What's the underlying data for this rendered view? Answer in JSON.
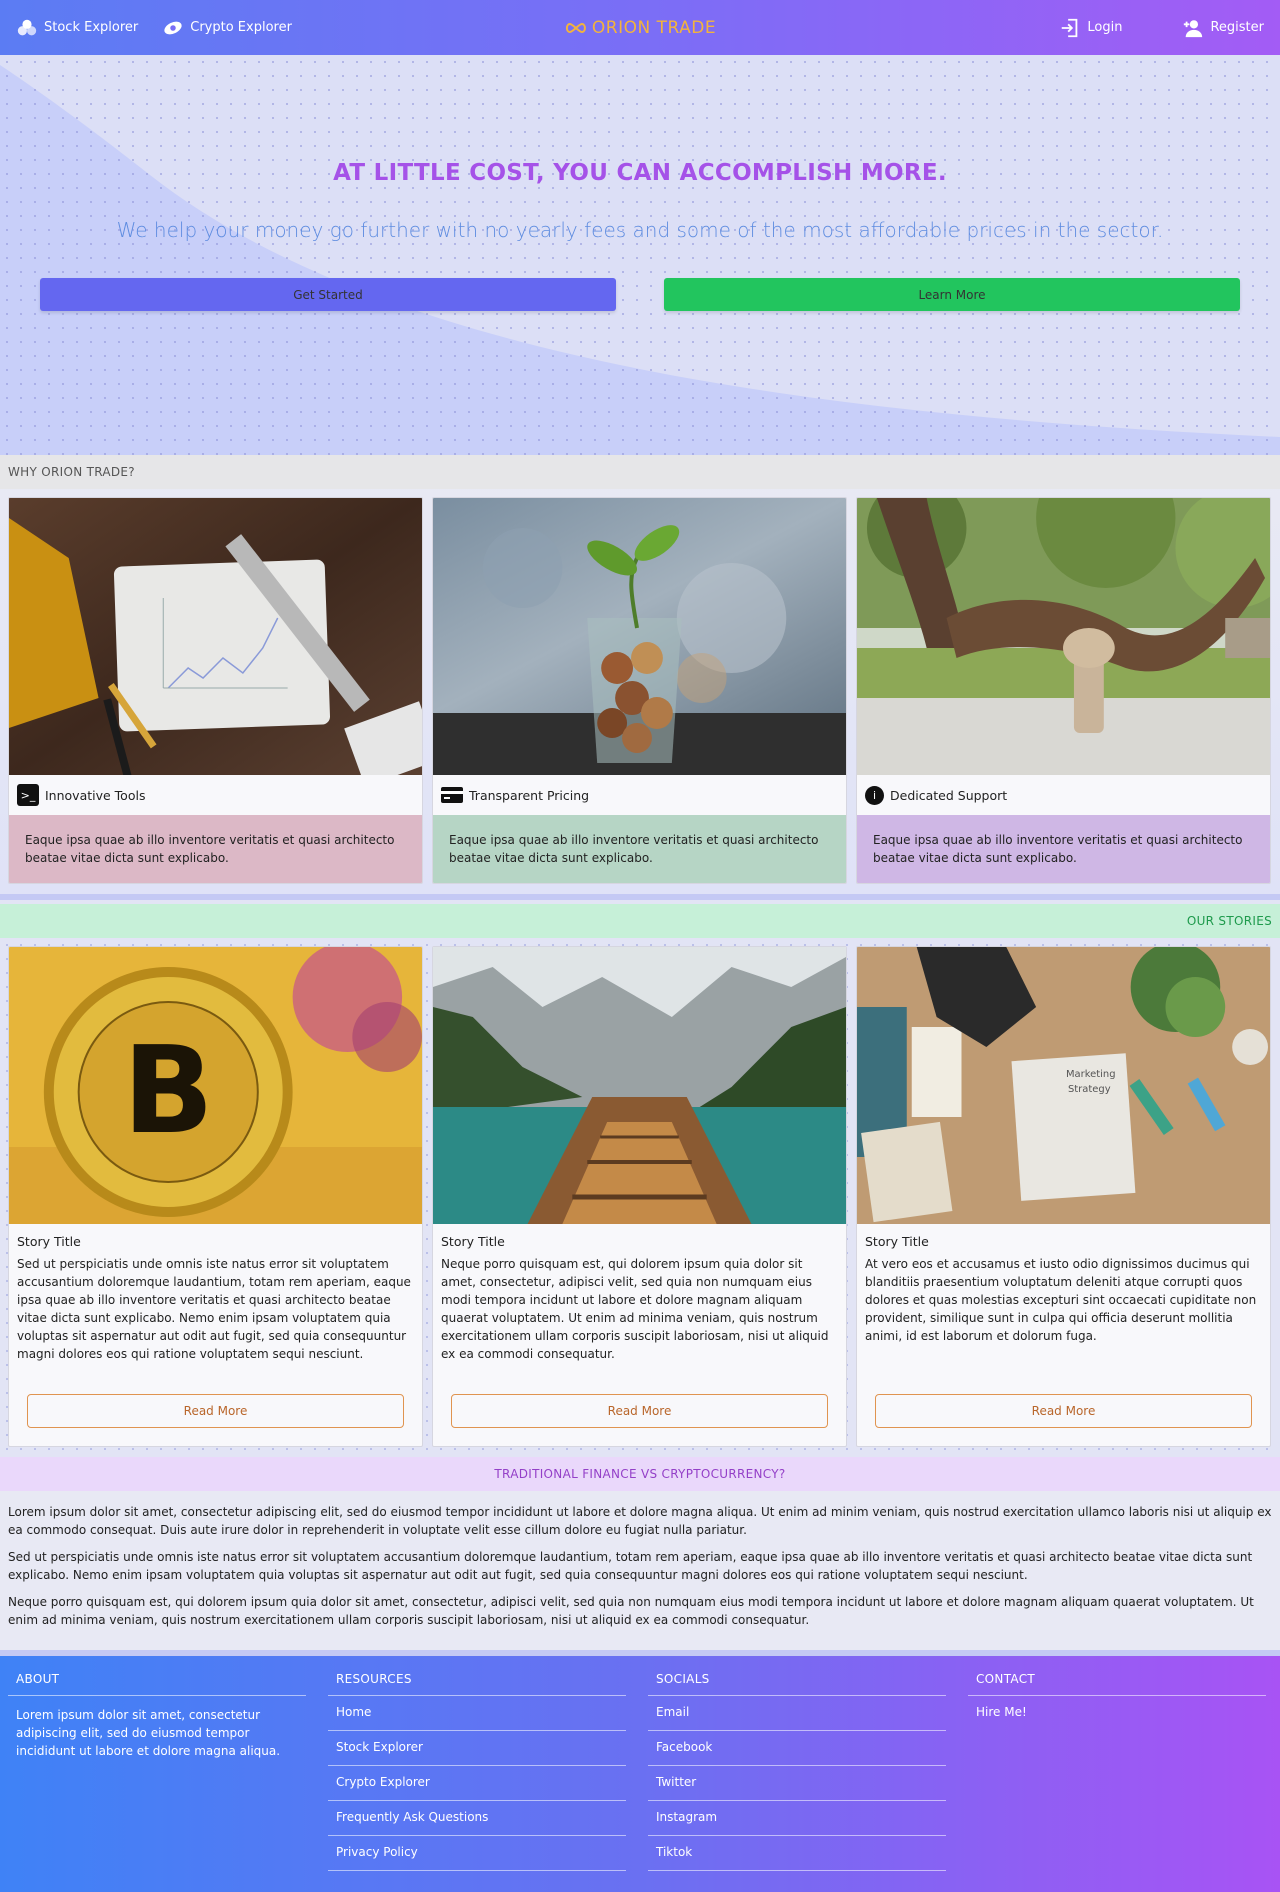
{
  "nav": {
    "stock_label": "Stock Explorer",
    "crypto_label": "Crypto Explorer",
    "brand": "ORION TRADE",
    "login_label": "Login",
    "register_label": "Register"
  },
  "hero": {
    "title": "AT LITTLE COST, YOU CAN ACCOMPLISH MORE.",
    "subtitle": "We help your money go further with no yearly fees and some of the most affordable prices in the sector.",
    "get_started": "Get Started",
    "learn_more": "Learn More"
  },
  "why": {
    "heading": "WHY ORION TRADE?",
    "cards": [
      {
        "title": "Innovative Tools",
        "icon": "terminal-icon",
        "text": "Eaque ipsa quae ab illo inventore veritatis et quasi architecto beatae vitae dicta sunt explicabo."
      },
      {
        "title": "Transparent Pricing",
        "icon": "credit-card-icon",
        "text": "Eaque ipsa quae ab illo inventore veritatis et quasi architecto beatae vitae dicta sunt explicabo."
      },
      {
        "title": "Dedicated Support",
        "icon": "info-icon",
        "text": "Eaque ipsa quae ab illo inventore veritatis et quasi architecto beatae vitae dicta sunt explicabo."
      }
    ]
  },
  "stories": {
    "heading": "OUR STORIES",
    "cards": [
      {
        "title": "Story Title",
        "text": "Sed ut perspiciatis unde omnis iste natus error sit voluptatem accusantium doloremque laudantium, totam rem aperiam, eaque ipsa quae ab illo inventore veritatis et quasi architecto beatae vitae dicta sunt explicabo. Nemo enim ipsam voluptatem quia voluptas sit aspernatur aut odit aut fugit, sed quia consequuntur magni dolores eos qui ratione voluptatem sequi nesciunt.",
        "button": "Read More"
      },
      {
        "title": "Story Title",
        "text": "Neque porro quisquam est, qui dolorem ipsum quia dolor sit amet, consectetur, adipisci velit, sed quia non numquam eius modi tempora incidunt ut labore et dolore magnam aliquam quaerat voluptatem. Ut enim ad minima veniam, quis nostrum exercitationem ullam corporis suscipit laboriosam, nisi ut aliquid ex ea commodi consequatur.",
        "button": "Read More"
      },
      {
        "title": "Story Title",
        "text": "At vero eos et accusamus et iusto odio dignissimos ducimus qui blanditiis praesentium voluptatum deleniti atque corrupti quos dolores et quas molestias excepturi sint occaecati cupiditate non provident, similique sunt in culpa qui officia deserunt mollitia animi, id est laborum et dolorum fuga.",
        "button": "Read More"
      }
    ]
  },
  "finance": {
    "heading": "TRADITIONAL FINANCE VS CRYPTOCURRENCY?",
    "paragraphs": [
      "Lorem ipsum dolor sit amet, consectetur adipiscing elit, sed do eiusmod tempor incididunt ut labore et dolore magna aliqua. Ut enim ad minim veniam, quis nostrud exercitation ullamco laboris nisi ut aliquip ex ea commodo consequat. Duis aute irure dolor in reprehenderit in voluptate velit esse cillum dolore eu fugiat nulla pariatur.",
      "Sed ut perspiciatis unde omnis iste natus error sit voluptatem accusantium doloremque laudantium, totam rem aperiam, eaque ipsa quae ab illo inventore veritatis et quasi architecto beatae vitae dicta sunt explicabo. Nemo enim ipsam voluptatem quia voluptas sit aspernatur aut odit aut fugit, sed quia consequuntur magni dolores eos qui ratione voluptatem sequi nesciunt.",
      "Neque porro quisquam est, qui dolorem ipsum quia dolor sit amet, consectetur, adipisci velit, sed quia non numquam eius modi tempora incidunt ut labore et dolore magnam aliquam quaerat voluptatem. Ut enim ad minima veniam, quis nostrum exercitationem ullam corporis suscipit laboriosam, nisi ut aliquid ex ea commodi consequatur."
    ]
  },
  "footer": {
    "about": {
      "heading": "ABOUT",
      "text": "Lorem ipsum dolor sit amet, consectetur adipiscing elit, sed do eiusmod tempor incididunt ut labore et dolore magna aliqua."
    },
    "resources": {
      "heading": "RESOURCES",
      "links": [
        "Home",
        "Stock Explorer",
        "Crypto Explorer",
        "Frequently Ask Questions",
        "Privacy Policy"
      ]
    },
    "socials": {
      "heading": "SOCIALS",
      "links": [
        "Email",
        "Facebook",
        "Twitter",
        "Instagram",
        "Tiktok"
      ]
    },
    "contact": {
      "heading": "CONTACT",
      "links": [
        "Hire Me!"
      ]
    }
  },
  "colors": {
    "brand": "#f2b33d",
    "hero_title": "#a552e8",
    "hero_subtitle": "#5e8ce0",
    "get_started": "#6467f0",
    "learn_more": "#22c55e",
    "read_more_border": "#e09450"
  }
}
